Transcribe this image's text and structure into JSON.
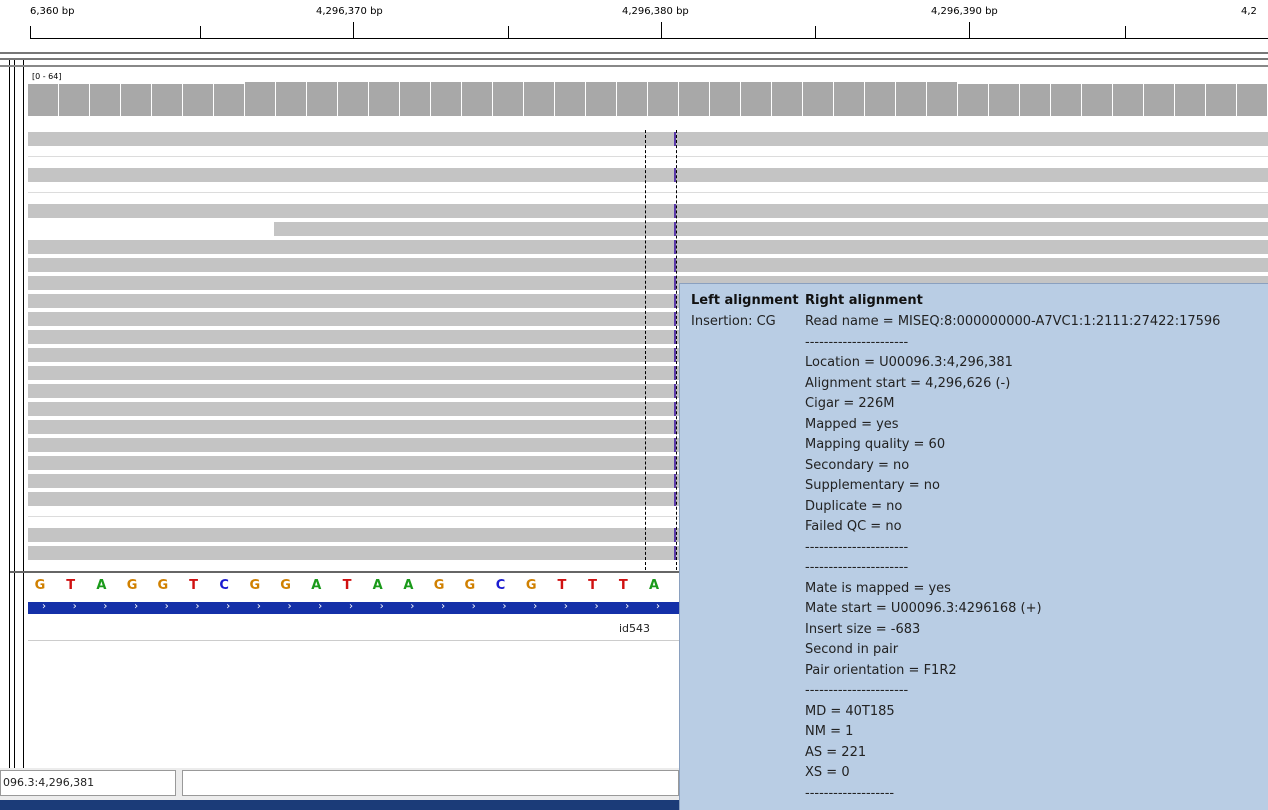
{
  "ruler": {
    "labels": [
      "6,360 bp",
      "4,296,370 bp",
      "4,296,380 bp",
      "4,296,390 bp",
      "4,2"
    ]
  },
  "coverage": {
    "range": "[0 - 64]"
  },
  "sequence": {
    "bases": [
      "G",
      "T",
      "A",
      "G",
      "G",
      "T",
      "C",
      "G",
      "G",
      "A",
      "T",
      "A",
      "A",
      "G",
      "G",
      "C",
      "G",
      "T",
      "T",
      "T",
      "A"
    ],
    "colors": {
      "A": "#1a9a1a",
      "C": "#1a1ad0",
      "G": "#d08000",
      "T": "#d01010"
    }
  },
  "feature": {
    "name": "id543"
  },
  "popup": {
    "left_header": "Left alignment",
    "right_header": "Right alignment",
    "insertion": "Insertion: CG",
    "lines": [
      "Read name = MISEQ:8:000000000-A7VC1:1:2111:27422:17596",
      "----------------------",
      "Location = U00096.3:4,296,381",
      "Alignment start = 4,296,626 (-)",
      "Cigar = 226M",
      "Mapped = yes",
      "Mapping quality = 60",
      "Secondary = no",
      "Supplementary = no",
      "Duplicate = no",
      "Failed QC = no",
      "----------------------",
      "----------------------",
      "Mate is mapped = yes",
      "Mate start = U00096.3:4296168 (+)",
      "Insert size = -683",
      "Second in pair",
      "Pair orientation = F1R2",
      "----------------------",
      "MD = 40T185",
      "NM = 1",
      "AS = 221",
      "XS = 0",
      "-------------------"
    ]
  },
  "status": {
    "locus": "096.3:4,296,381"
  }
}
